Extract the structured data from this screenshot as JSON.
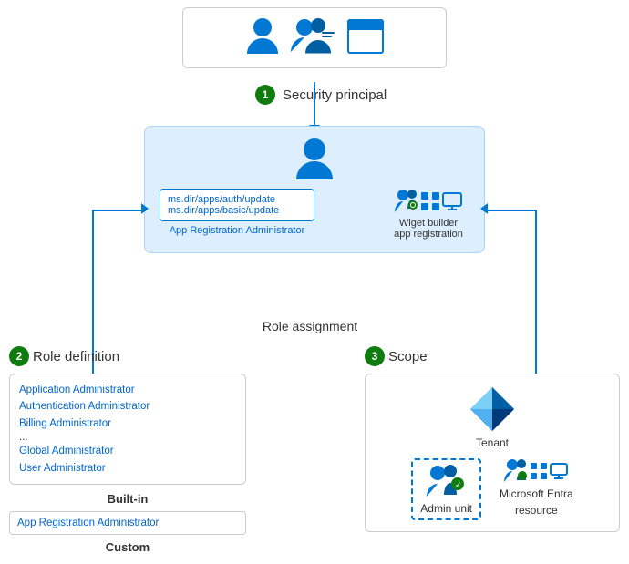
{
  "step1": {
    "number": "1",
    "label": "Security principal"
  },
  "step2": {
    "number": "2",
    "label": "Role definition"
  },
  "step3": {
    "number": "3",
    "label": "Scope"
  },
  "roleAssignment": {
    "title": "Role assignment",
    "permissions": [
      "ms.dir/apps/auth/update",
      "ms.dir/apps/basic/update"
    ],
    "adminLabel": "App Registration Administrator",
    "widgetLabel": "Wiget builder\napp registration"
  },
  "roleDefinition": {
    "builtinLabel": "Built-in",
    "customLabel": "Custom",
    "roles": [
      "Application Administrator",
      "Authentication Administrator",
      "Billing Administrator",
      "...",
      "Global Administrator",
      "User Administrator"
    ],
    "customRole": "App Registration Administrator"
  },
  "scope": {
    "tenant": "Tenant",
    "adminUnit": "Admin unit",
    "msEntra": "Microsoft Entra\nresource"
  }
}
